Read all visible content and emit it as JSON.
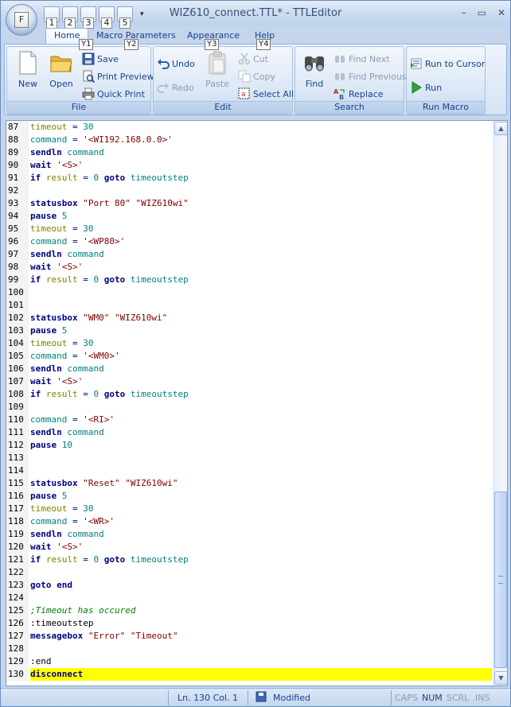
{
  "window": {
    "title": "WIZ610_connect.TTL* - TTLEditor",
    "controls": [
      "–",
      "▭",
      "✕"
    ]
  },
  "app_button": {
    "label": "F"
  },
  "quick_access": {
    "keytips": [
      "1",
      "2",
      "3",
      "4",
      "5"
    ],
    "customize_arrow": "▾"
  },
  "ribbon": {
    "tabs": [
      "Home",
      "Macro Parameters",
      "Appearance",
      "Help"
    ],
    "active_tab": "Home",
    "tab_keytips": [
      "Y1",
      "Y2",
      "Y3",
      "Y4"
    ],
    "groups": {
      "file": {
        "label": "File",
        "new": "New",
        "open": "Open",
        "save": "Save",
        "print_preview": "Print Preview",
        "quick_print": "Quick Print"
      },
      "edit": {
        "label": "Edit",
        "undo": "Undo",
        "redo": "Redo",
        "paste": "Paste",
        "cut": "Cut",
        "copy": "Copy",
        "select_all": "Select All"
      },
      "search": {
        "label": "Search",
        "find": "Find",
        "find_next": "Find Next",
        "find_previous": "Find Previous",
        "replace": "Replace"
      },
      "run_macro": {
        "label": "Run Macro",
        "run_to_cursor": "Run to Cursor",
        "run": "Run"
      }
    }
  },
  "editor": {
    "lines": [
      {
        "n": "87",
        "t": [
          [
            "var",
            "timeout"
          ],
          [
            "op",
            " = "
          ],
          [
            "num",
            "30"
          ]
        ]
      },
      {
        "n": "88",
        "t": [
          [
            "idn",
            "command"
          ],
          [
            "op",
            " = "
          ],
          [
            "str",
            "'<WI192.168.0.0>'"
          ]
        ]
      },
      {
        "n": "89",
        "t": [
          [
            "kw",
            "sendln"
          ],
          [
            "plain",
            " "
          ],
          [
            "idn",
            "command"
          ]
        ]
      },
      {
        "n": "90",
        "t": [
          [
            "kw",
            "wait"
          ],
          [
            "plain",
            " "
          ],
          [
            "str",
            "'<S>'"
          ]
        ]
      },
      {
        "n": "91",
        "t": [
          [
            "kw",
            "if"
          ],
          [
            "plain",
            " "
          ],
          [
            "var",
            "result"
          ],
          [
            "op",
            " = "
          ],
          [
            "num",
            "0"
          ],
          [
            "plain",
            " "
          ],
          [
            "kw",
            "goto"
          ],
          [
            "plain",
            " "
          ],
          [
            "idn",
            "timeoutstep"
          ]
        ]
      },
      {
        "n": "92",
        "t": []
      },
      {
        "n": "93",
        "t": [
          [
            "kw",
            "statusbox"
          ],
          [
            "plain",
            " "
          ],
          [
            "str",
            "\"Port 80\""
          ],
          [
            "plain",
            " "
          ],
          [
            "str",
            "\"WIZ610wi\""
          ]
        ]
      },
      {
        "n": "94",
        "t": [
          [
            "kw",
            "pause"
          ],
          [
            "plain",
            " "
          ],
          [
            "num",
            "5"
          ]
        ]
      },
      {
        "n": "95",
        "t": [
          [
            "var",
            "timeout"
          ],
          [
            "op",
            " = "
          ],
          [
            "num",
            "30"
          ]
        ]
      },
      {
        "n": "96",
        "t": [
          [
            "idn",
            "command"
          ],
          [
            "op",
            " = "
          ],
          [
            "str",
            "'<WP80>'"
          ]
        ]
      },
      {
        "n": "97",
        "t": [
          [
            "kw",
            "sendln"
          ],
          [
            "plain",
            " "
          ],
          [
            "idn",
            "command"
          ]
        ]
      },
      {
        "n": "98",
        "t": [
          [
            "kw",
            "wait"
          ],
          [
            "plain",
            " "
          ],
          [
            "str",
            "'<S>'"
          ]
        ]
      },
      {
        "n": "99",
        "t": [
          [
            "kw",
            "if"
          ],
          [
            "plain",
            " "
          ],
          [
            "var",
            "result"
          ],
          [
            "op",
            " = "
          ],
          [
            "num",
            "0"
          ],
          [
            "plain",
            " "
          ],
          [
            "kw",
            "goto"
          ],
          [
            "plain",
            " "
          ],
          [
            "idn",
            "timeoutstep"
          ]
        ]
      },
      {
        "n": "100",
        "t": []
      },
      {
        "n": "101",
        "t": []
      },
      {
        "n": "102",
        "t": [
          [
            "kw",
            "statusbox"
          ],
          [
            "plain",
            " "
          ],
          [
            "str",
            "\"WM0\""
          ],
          [
            "plain",
            " "
          ],
          [
            "str",
            "\"WIZ610wi\""
          ]
        ]
      },
      {
        "n": "103",
        "t": [
          [
            "kw",
            "pause"
          ],
          [
            "plain",
            " "
          ],
          [
            "num",
            "5"
          ]
        ]
      },
      {
        "n": "104",
        "t": [
          [
            "var",
            "timeout"
          ],
          [
            "op",
            " = "
          ],
          [
            "num",
            "30"
          ]
        ]
      },
      {
        "n": "105",
        "t": [
          [
            "idn",
            "command"
          ],
          [
            "op",
            " = "
          ],
          [
            "str",
            "'<WM0>'"
          ]
        ]
      },
      {
        "n": "106",
        "t": [
          [
            "kw",
            "sendln"
          ],
          [
            "plain",
            " "
          ],
          [
            "idn",
            "command"
          ]
        ]
      },
      {
        "n": "107",
        "t": [
          [
            "kw",
            "wait"
          ],
          [
            "plain",
            " "
          ],
          [
            "str",
            "'<S>'"
          ]
        ]
      },
      {
        "n": "108",
        "t": [
          [
            "kw",
            "if"
          ],
          [
            "plain",
            " "
          ],
          [
            "var",
            "result"
          ],
          [
            "op",
            " = "
          ],
          [
            "num",
            "0"
          ],
          [
            "plain",
            " "
          ],
          [
            "kw",
            "goto"
          ],
          [
            "plain",
            " "
          ],
          [
            "idn",
            "timeoutstep"
          ]
        ]
      },
      {
        "n": "109",
        "t": []
      },
      {
        "n": "110",
        "t": [
          [
            "idn",
            "command"
          ],
          [
            "op",
            " = "
          ],
          [
            "str",
            "'<RI>'"
          ]
        ]
      },
      {
        "n": "111",
        "t": [
          [
            "kw",
            "sendln"
          ],
          [
            "plain",
            " "
          ],
          [
            "idn",
            "command"
          ]
        ]
      },
      {
        "n": "112",
        "t": [
          [
            "kw",
            "pause"
          ],
          [
            "plain",
            " "
          ],
          [
            "num",
            "10"
          ]
        ]
      },
      {
        "n": "113",
        "t": []
      },
      {
        "n": "114",
        "t": []
      },
      {
        "n": "115",
        "t": [
          [
            "kw",
            "statusbox"
          ],
          [
            "plain",
            " "
          ],
          [
            "str",
            "\"Reset\""
          ],
          [
            "plain",
            " "
          ],
          [
            "str",
            "\"WIZ610wi\""
          ]
        ]
      },
      {
        "n": "116",
        "t": [
          [
            "kw",
            "pause"
          ],
          [
            "plain",
            " "
          ],
          [
            "num",
            "5"
          ]
        ]
      },
      {
        "n": "117",
        "t": [
          [
            "var",
            "timeout"
          ],
          [
            "op",
            " = "
          ],
          [
            "num",
            "30"
          ]
        ]
      },
      {
        "n": "118",
        "t": [
          [
            "idn",
            "command"
          ],
          [
            "op",
            " = "
          ],
          [
            "str",
            "'<WR>'"
          ]
        ]
      },
      {
        "n": "119",
        "t": [
          [
            "kw",
            "sendln"
          ],
          [
            "plain",
            " "
          ],
          [
            "idn",
            "command"
          ]
        ]
      },
      {
        "n": "120",
        "t": [
          [
            "kw",
            "wait"
          ],
          [
            "plain",
            " "
          ],
          [
            "str",
            "'<S>'"
          ]
        ]
      },
      {
        "n": "121",
        "t": [
          [
            "kw",
            "if"
          ],
          [
            "plain",
            " "
          ],
          [
            "var",
            "result"
          ],
          [
            "op",
            " = "
          ],
          [
            "num",
            "0"
          ],
          [
            "plain",
            " "
          ],
          [
            "kw",
            "goto"
          ],
          [
            "plain",
            " "
          ],
          [
            "idn",
            "timeoutstep"
          ]
        ]
      },
      {
        "n": "122",
        "t": []
      },
      {
        "n": "123",
        "t": [
          [
            "kw",
            "goto"
          ],
          [
            "plain",
            " "
          ],
          [
            "kw",
            "end"
          ]
        ]
      },
      {
        "n": "124",
        "t": []
      },
      {
        "n": "125",
        "t": [
          [
            "cmt",
            ";Timeout has occured"
          ]
        ]
      },
      {
        "n": "126",
        "t": [
          [
            "lbl",
            ":timeoutstep"
          ]
        ]
      },
      {
        "n": "127",
        "t": [
          [
            "kw",
            "messagebox"
          ],
          [
            "plain",
            " "
          ],
          [
            "str",
            "\"Error\""
          ],
          [
            "plain",
            " "
          ],
          [
            "str",
            "\"Timeout\""
          ]
        ]
      },
      {
        "n": "128",
        "t": []
      },
      {
        "n": "129",
        "t": [
          [
            "lbl",
            ":end"
          ]
        ]
      },
      {
        "n": "130",
        "t": [
          [
            "kw",
            "disconnect"
          ]
        ],
        "highlight": true
      }
    ]
  },
  "status_bar": {
    "position": "Ln. 130   Col. 1",
    "state": "Modified",
    "caps": "CAPS",
    "num": "NUM",
    "scrl": "SCRL",
    "ins": "INS"
  }
}
